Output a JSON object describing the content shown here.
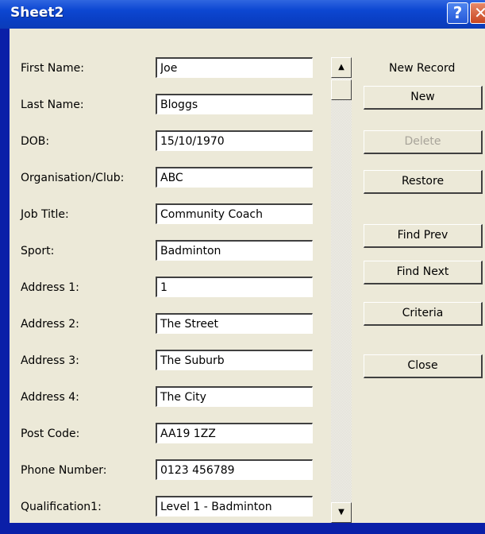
{
  "window": {
    "title": "Sheet2",
    "help_label": "?",
    "close_label": "✕"
  },
  "form": {
    "fields": [
      {
        "label": "First Name:",
        "value": "Joe"
      },
      {
        "label": "Last Name:",
        "value": "Bloggs"
      },
      {
        "label": "DOB:",
        "value": "15/10/1970"
      },
      {
        "label": "Organisation/Club:",
        "value": "ABC"
      },
      {
        "label": "Job Title:",
        "value": "Community Coach"
      },
      {
        "label": "Sport:",
        "value": "Badminton"
      },
      {
        "label": "Address 1:",
        "value": "1"
      },
      {
        "label": "Address 2:",
        "value": "The Street"
      },
      {
        "label": "Address 3:",
        "value": "The Suburb"
      },
      {
        "label": "Address 4:",
        "value": "The City"
      },
      {
        "label": "Post Code:",
        "value": "AA19 1ZZ"
      },
      {
        "label": "Phone Number:",
        "value": "0123 456789"
      },
      {
        "label": "Qualification1:",
        "value": "Level 1 - Badminton"
      }
    ]
  },
  "scrollbar": {
    "up_glyph": "▲",
    "down_glyph": "▼"
  },
  "sidebar": {
    "record_status": "New Record",
    "buttons": {
      "new": "New",
      "delete": "Delete",
      "restore": "Restore",
      "find_prev": "Find Prev",
      "find_next": "Find Next",
      "criteria": "Criteria",
      "close": "Close"
    }
  }
}
